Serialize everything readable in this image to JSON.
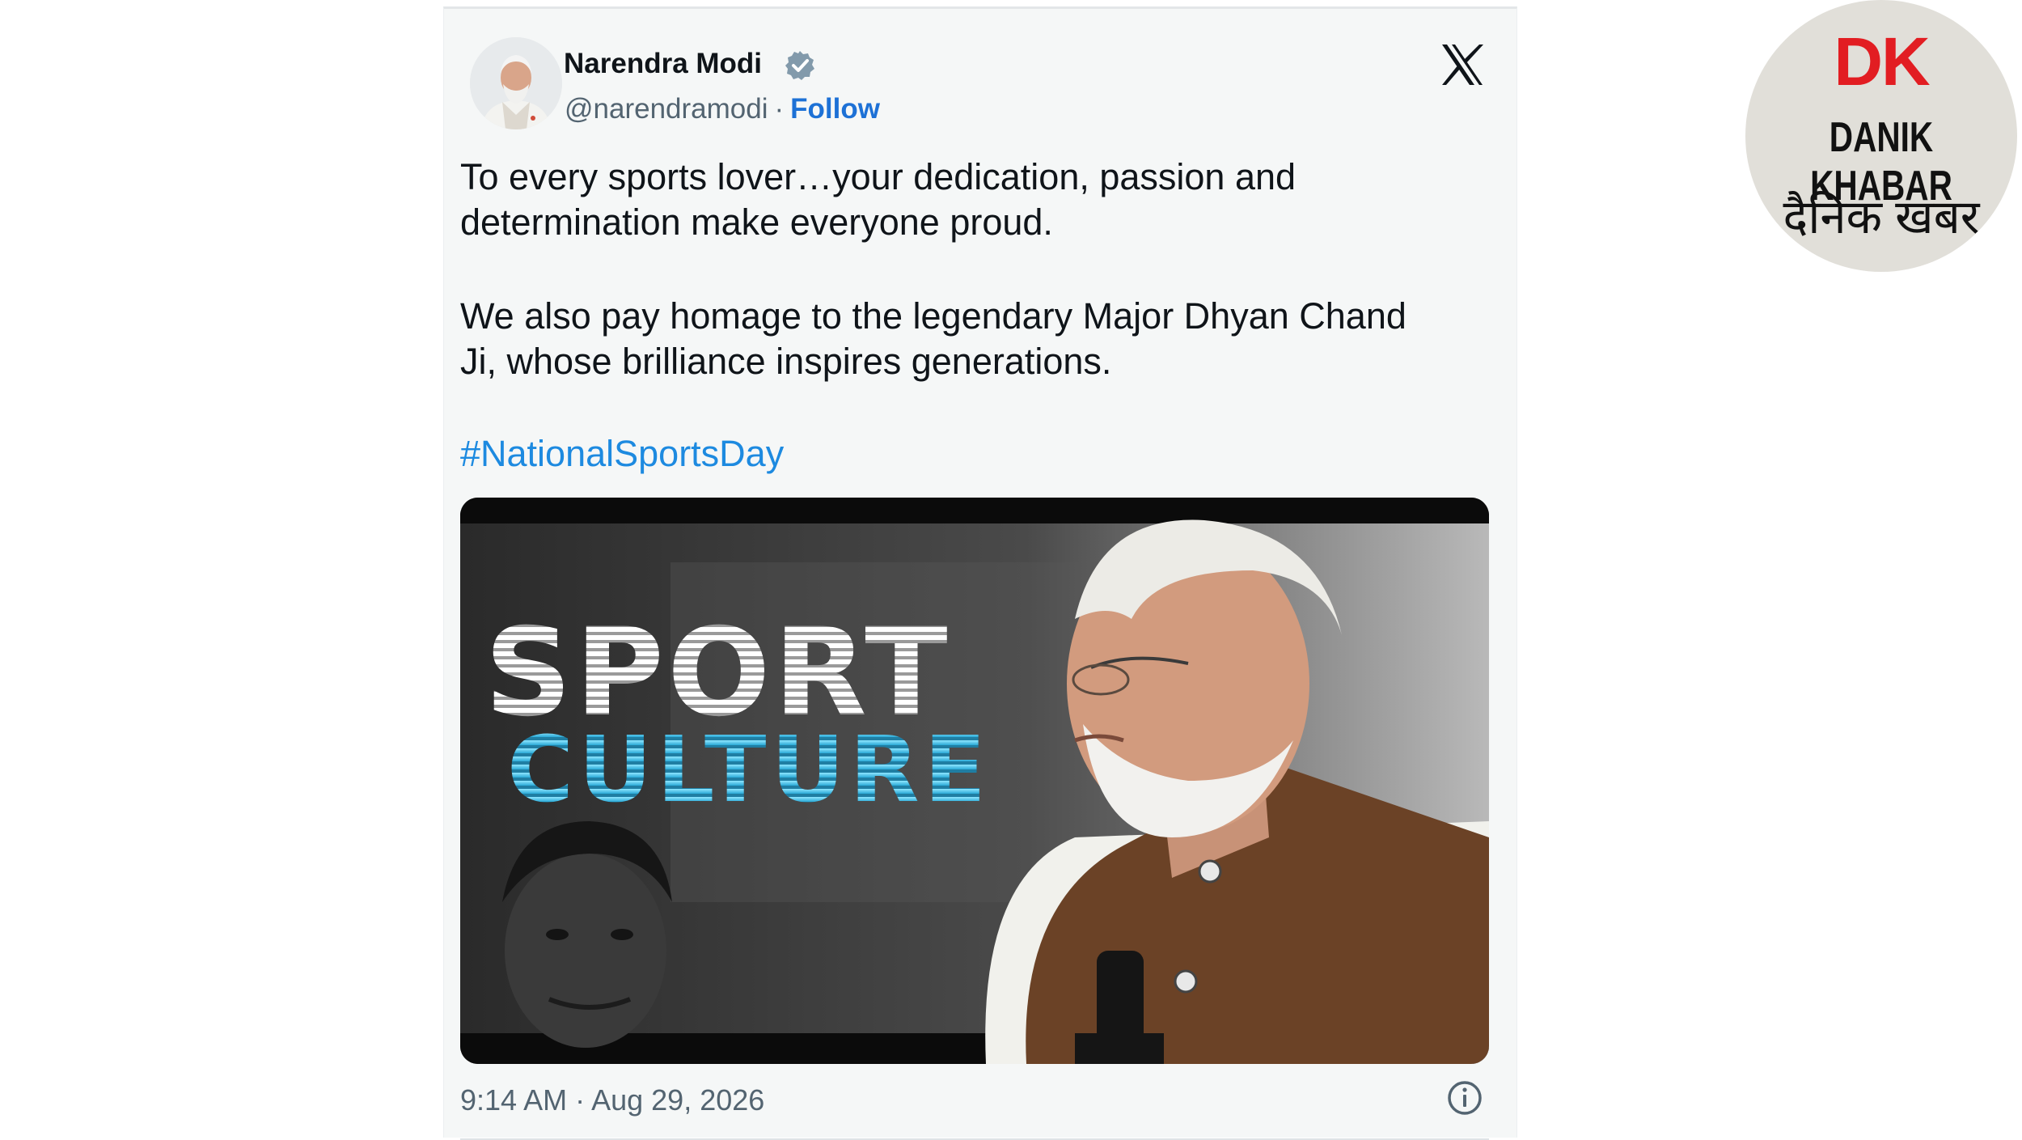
{
  "tweet": {
    "author_name": "Narendra Modi",
    "handle": "@narendramodi",
    "separator": "·",
    "follow_label": "Follow",
    "text_paragraph_1": "To every sports lover…your dedication, passion and determination make everyone proud.",
    "text_paragraph_2": "We also pay homage to the legendary Major Dhyan Chand Ji, whose brilliance inspires generations.",
    "hashtag": "#NationalSportsDay",
    "media": {
      "headline_line_1": "SPORT",
      "headline_line_2": "CULTURE"
    },
    "timestamp": "9:14 AM · Aug 29, 2026",
    "icons": [
      "verified-badge-icon",
      "x-logo-icon",
      "info-icon"
    ]
  },
  "watermark": {
    "logo": "DK",
    "name": "DANIK KHABAR",
    "name_hindi": "दैनिक खबर"
  },
  "colors": {
    "card_background": "#f5f7f7",
    "follow_link": "#1d71d6",
    "hashtag": "#1d8ae0",
    "verified_badge": "#829aab",
    "headline_cyan": "#3cc3e8",
    "watermark_red": "#e21d22",
    "vest_brown": "#6b4226"
  }
}
